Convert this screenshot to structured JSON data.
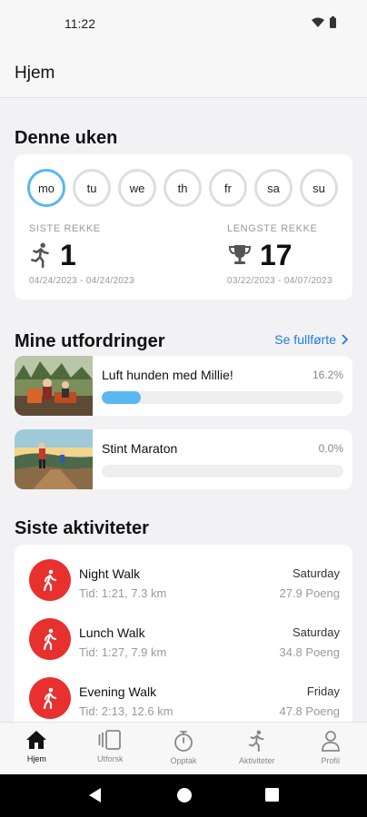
{
  "status": {
    "time": "11:22"
  },
  "app_bar": {
    "title": "Hjem"
  },
  "week": {
    "title": "Denne uken",
    "days": [
      "mo",
      "tu",
      "we",
      "th",
      "fr",
      "sa",
      "su"
    ],
    "active_day": "mo",
    "current_streak": {
      "label": "SISTE REKKE",
      "value": "1",
      "dates": "04/24/2023 - 04/24/2023"
    },
    "longest_streak": {
      "label": "LENGSTE REKKE",
      "value": "17",
      "dates": "03/22/2023 - 04/07/2023"
    }
  },
  "challenges": {
    "title": "Mine utfordringer",
    "see_completed": "Se fullførte",
    "items": [
      {
        "name": "Luft hunden med Millie!",
        "percent_label": "16.2%",
        "progress": 0.162
      },
      {
        "name": "Stint Maraton",
        "percent_label": "0.0%",
        "progress": 0.0
      }
    ]
  },
  "activities": {
    "title": "Siste aktiviteter",
    "items": [
      {
        "name": "Night Walk",
        "details": "Tid: 1:21, 7.3 km",
        "day": "Saturday",
        "points": "27.9 Poeng"
      },
      {
        "name": "Lunch Walk",
        "details": "Tid: 1:27, 7.9 km",
        "day": "Saturday",
        "points": "34.8 Poeng"
      },
      {
        "name": "Evening Walk",
        "details": "Tid: 2:13, 12.6 km",
        "day": "Friday",
        "points": "47.8 Poeng"
      }
    ]
  },
  "nav": {
    "items": [
      {
        "label": "Hjem",
        "icon": "home-icon",
        "active": true
      },
      {
        "label": "Utforsk",
        "icon": "cards-icon",
        "active": false
      },
      {
        "label": "Opptak",
        "icon": "stopwatch-icon",
        "active": false
      },
      {
        "label": "Aktiviteter",
        "icon": "runner-icon",
        "active": false
      },
      {
        "label": "Profil",
        "icon": "person-icon",
        "active": false
      }
    ]
  },
  "colors": {
    "accent": "#5ab7f0",
    "link": "#1f7ae0",
    "activity_red": "#e8312f"
  }
}
